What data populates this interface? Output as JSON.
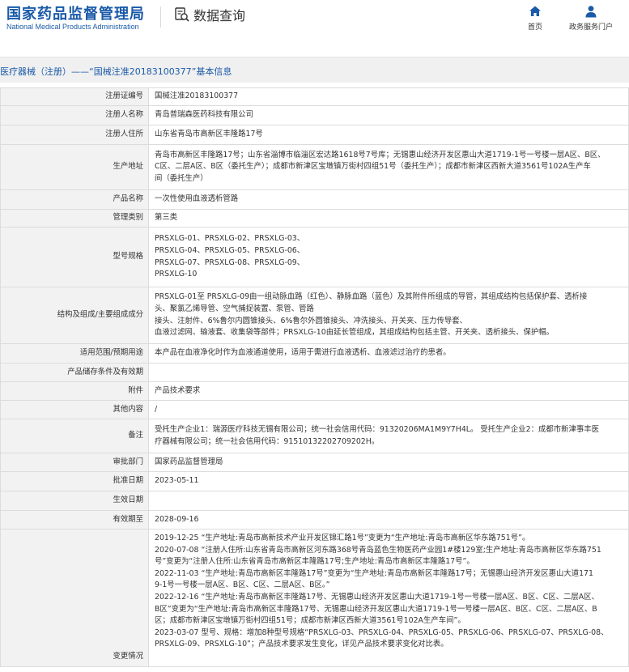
{
  "header": {
    "logo_cn": "国家药品监督管理局",
    "logo_en": "National Medical Products Administration",
    "query_title": "数据查询",
    "nav_home": "首页",
    "nav_portal": "政务服务门户"
  },
  "breadcrumb": "医疗器械（注册）——“国械注准20183100377”基本信息",
  "rows": [
    {
      "label": "注册证编号",
      "lines": [
        "国械注准20183100377"
      ]
    },
    {
      "label": "注册人名称",
      "lines": [
        "青岛普瑞森医药科技有限公司"
      ]
    },
    {
      "label": "注册人住所",
      "lines": [
        "山东省青岛市高新区丰隆路17号"
      ]
    },
    {
      "label": "生产地址",
      "lines": [
        "青岛市高新区丰隆路17号；山东省淄博市临淄区宏达路1618号7号库；无锡惠山经济开发区惠山大道1719-1号一号楼一层A区、B区、",
        "C区、二层A区、B区（委托生产）；成都市新津区宝墩镇万街村四组51号（委托生产）；成都市新津区西新大道3561号102A生产车",
        "间（委托生产）"
      ]
    },
    {
      "label": "产品名称",
      "lines": [
        "一次性使用血液透析管路"
      ]
    },
    {
      "label": "管理类别",
      "lines": [
        "第三类"
      ]
    },
    {
      "label": "型号规格",
      "lines": [
        "PRSXLG-01、PRSXLG-02、PRSXLG-03、",
        "PRSXLG-04、PRSXLG-05、PRSXLG-06、",
        "PRSXLG-07、PRSXLG-08、PRSXLG-09、",
        "PRSXLG-10"
      ]
    },
    {
      "label": "结构及组成/主要组成成分",
      "lines": [
        "PRSXLG-01至 PRSXLG-09由一组动脉血路（红色）、静脉血路（蓝色）及其附件所组成的导管，其组成结构包括保护套、透析接",
        "头、聚氯乙烯导管、空气捕捉装置、泵管、管路",
        "接头、注射件、6%鲁尔内圆锥接头、6%鲁尔外圆锥接头、冲洗接头、开关夹、压力传导套、",
        "血液过滤网、输液套、收集袋等部件；PRSXLG-10由延长管组成，其组成结构包括主管、开关夹、透析接头、保护帽。"
      ]
    },
    {
      "label": "适用范围/预期用途",
      "lines": [
        "本产品在血液净化时作为血液通道使用，适用于需进行血液透析、血液滤过治疗的患者。"
      ]
    },
    {
      "label": "产品储存条件及有效期",
      "lines": [
        ""
      ]
    },
    {
      "label": "附件",
      "lines": [
        "产品技术要求"
      ]
    },
    {
      "label": "其他内容",
      "lines": [
        "/"
      ]
    },
    {
      "label": "备注",
      "lines": [
        "受托生产企业1：瑞源医疗科技无锡有限公司；统一社会信用代码：91320206MA1M9Y7H4L。 受托生产企业2：成都市新津事丰医",
        "疗器械有限公司；统一社会信用代码：91510132202709202H。"
      ]
    },
    {
      "label": "审批部门",
      "lines": [
        "国家药品监督管理局"
      ]
    },
    {
      "label": "批准日期",
      "lines": [
        "2023-05-11"
      ]
    },
    {
      "label": "生效日期",
      "lines": [
        ""
      ]
    },
    {
      "label": "有效期至",
      "lines": [
        "2028-09-16"
      ]
    },
    {
      "label": "变更情况",
      "lines": [
        "2019-12-25 “生产地址:青岛市高新技术产业开发区锦汇路1号”变更为“生产地址:青岛市高新区华东路751号”。",
        "2020-07-08 “注册人住所:山东省青岛市高新区河东路368号青岛蓝色生物医药产业园1#楼129室;生产地址:青岛市高新区华东路751",
        "号”变更为“注册人住所:山东省青岛市高新区丰隆路17号;生产地址:青岛市高新区丰隆路17号”。",
        "2022-11-03 “生产地址:青岛市高新区丰隆路17号”变更为“生产地址:青岛市高新区丰隆路17号；无锡惠山经济开发区惠山大道171",
        "9-1号一号楼一层A区、B区、C区、二层A区、B区。”",
        "2022-12-16 “生产地址:青岛市高新区丰隆路17号、无锡惠山经济开发区惠山大道1719-1号一号楼一层A区、B区、C区、二层A区、",
        "B区”变更为“生产地址:青岛市高新区丰隆路17号、无锡惠山经济开发区惠山大道1719-1号一号楼一层A区、B区、C区、二层A区、B",
        "区；成都市新津区宝墩镇万街村四组51号；成都市新津区西新大道3561号102A生产车间”。",
        "2023-03-07 型号、规格：增加8种型号规格“PRSXLG-03、PRSXLG-04、PRSXLG-05、PRSXLG-06、PRSXLG-07、PRSXLG-08、",
        "PRSXLG-09、PRSXLG-10”；产品技术要求发生变化，详见产品技术要求变化对比表。"
      ]
    }
  ]
}
